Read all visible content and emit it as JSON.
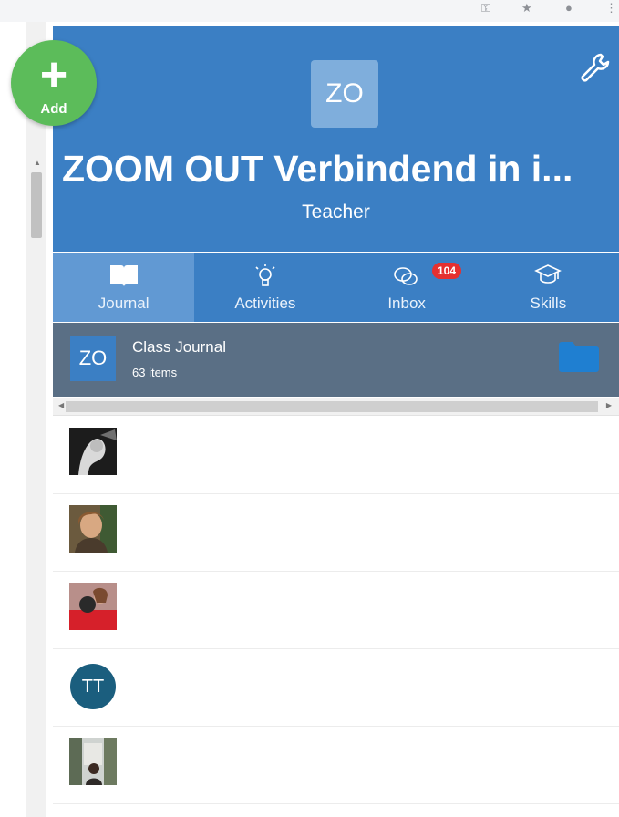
{
  "browser": {
    "icons": [
      "key-icon",
      "star-icon",
      "profile-icon",
      "menu-dots-icon"
    ]
  },
  "add_button": {
    "label": "Add",
    "color": "#5cbc5a"
  },
  "header": {
    "logo_initials": "ZO",
    "class_title": "ZOOM OUT Verbindend in i...",
    "role": "Teacher",
    "color": "#3b7fc4",
    "settings_icon": "wrench-icon"
  },
  "tabs": [
    {
      "label": "Journal",
      "icon": "book-icon",
      "active": true
    },
    {
      "label": "Activities",
      "icon": "lightbulb-icon",
      "active": false
    },
    {
      "label": "Inbox",
      "icon": "chat-bubbles-icon",
      "active": false,
      "badge": "104"
    },
    {
      "label": "Skills",
      "icon": "graduation-cap-icon",
      "active": false
    }
  ],
  "journal": {
    "initials": "ZO",
    "title": "Class Journal",
    "count": "63 items",
    "icon": "folder-icon"
  },
  "students": [
    {
      "type": "photo",
      "style": "dark"
    },
    {
      "type": "photo",
      "style": "portrait"
    },
    {
      "type": "photo",
      "style": "red"
    },
    {
      "type": "initials",
      "initials": "TT"
    },
    {
      "type": "photo",
      "style": "outdoor"
    }
  ]
}
